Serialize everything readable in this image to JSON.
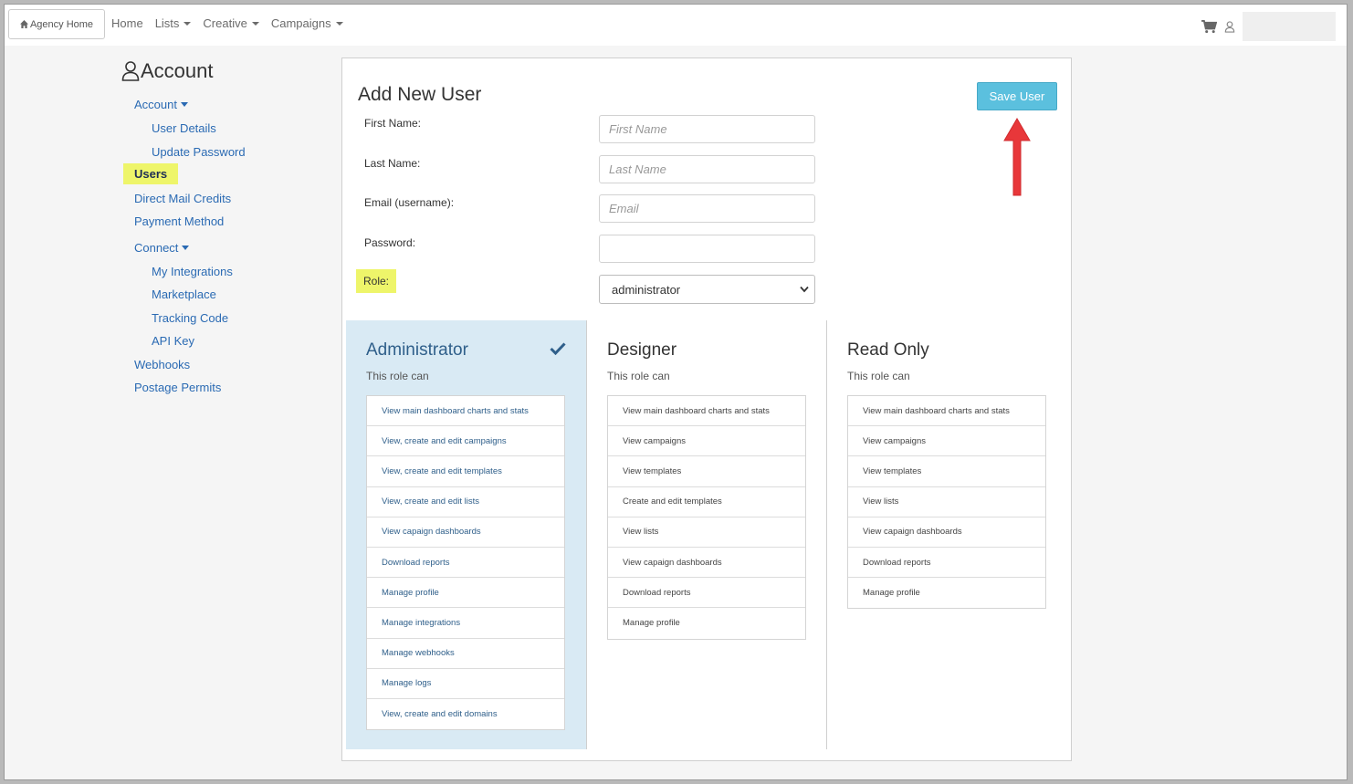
{
  "nav": {
    "agency_home": "Agency Home",
    "links": [
      {
        "label": "Home",
        "caret": false
      },
      {
        "label": "Lists",
        "caret": true
      },
      {
        "label": "Creative",
        "caret": true
      },
      {
        "label": "Campaigns",
        "caret": true
      }
    ]
  },
  "sidebar": {
    "title": "Account",
    "account_label": "Account",
    "user_details": "User Details",
    "update_password": "Update Password",
    "users": "Users",
    "direct_mail_credits": "Direct Mail Credits",
    "payment_method": "Payment Method",
    "connect_label": "Connect",
    "my_integrations": "My Integrations",
    "marketplace": "Marketplace",
    "tracking_code": "Tracking Code",
    "api_key": "API Key",
    "webhooks": "Webhooks",
    "postage_permits": "Postage Permits"
  },
  "form": {
    "title": "Add New User",
    "save_label": "Save User",
    "first_name_label": "First Name:",
    "first_name_placeholder": "First Name",
    "last_name_label": "Last Name:",
    "last_name_placeholder": "Last Name",
    "email_label": "Email (username):",
    "email_placeholder": "Email",
    "password_label": "Password:",
    "role_label": "Role:",
    "role_value": "administrator"
  },
  "roles": [
    {
      "name": "Administrator",
      "subtitle": "This role can",
      "selected": true,
      "permissions": [
        "View main dashboard charts and stats",
        "View, create and edit campaigns",
        "View, create and edit templates",
        "View, create and edit lists",
        "View capaign dashboards",
        "Download reports",
        "Manage profile",
        "Manage integrations",
        "Manage webhooks",
        "Manage logs",
        "View, create and edit domains"
      ]
    },
    {
      "name": "Designer",
      "subtitle": "This role can",
      "selected": false,
      "permissions": [
        "View main dashboard charts and stats",
        "View campaigns",
        "View templates",
        "Create and edit templates",
        "View lists",
        "View capaign dashboards",
        "Download reports",
        "Manage profile"
      ]
    },
    {
      "name": "Read Only",
      "subtitle": "This role can",
      "selected": false,
      "permissions": [
        "View main dashboard charts and stats",
        "View campaigns",
        "View templates",
        "View lists",
        "View capaign dashboards",
        "Download reports",
        "Manage profile"
      ]
    }
  ],
  "colors": {
    "accent": "#5bc0de",
    "link": "#2a6ab3",
    "highlight": "#eef56a",
    "selected_role_bg": "#d9eaf4",
    "annotation_arrow": "#e8373a"
  }
}
